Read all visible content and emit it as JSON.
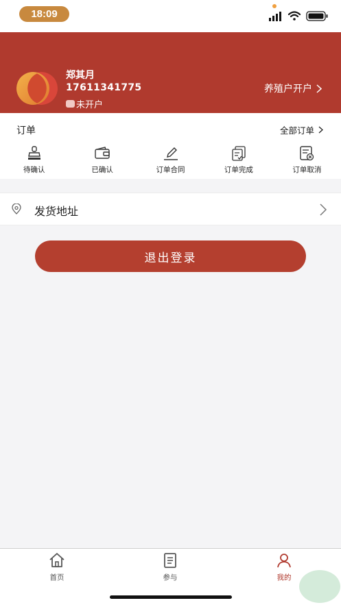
{
  "status_bar": {
    "time": "18:09"
  },
  "profile": {
    "name": "郑其月",
    "phone": "17611341775",
    "account_status": "未开户",
    "open_account_label": "养殖户开户"
  },
  "orders": {
    "title": "订单",
    "all_label": "全部订单",
    "items": [
      {
        "label": "待确认",
        "icon": "stamp-icon"
      },
      {
        "label": "已确认",
        "icon": "wallet-icon"
      },
      {
        "label": "订单合同",
        "icon": "pen-icon"
      },
      {
        "label": "订单完成",
        "icon": "document-check-icon"
      },
      {
        "label": "订单取消",
        "icon": "document-cancel-icon"
      }
    ]
  },
  "address": {
    "label": "发货地址"
  },
  "logout": {
    "label": "退出登录"
  },
  "tabs": [
    {
      "label": "首页",
      "icon": "home-icon"
    },
    {
      "label": "参与",
      "icon": "list-icon"
    },
    {
      "label": "我的",
      "icon": "user-icon",
      "active": true
    }
  ],
  "colors": {
    "brand": "#b03a2e",
    "button": "#b43f2f",
    "time_pill": "#c8893e"
  }
}
